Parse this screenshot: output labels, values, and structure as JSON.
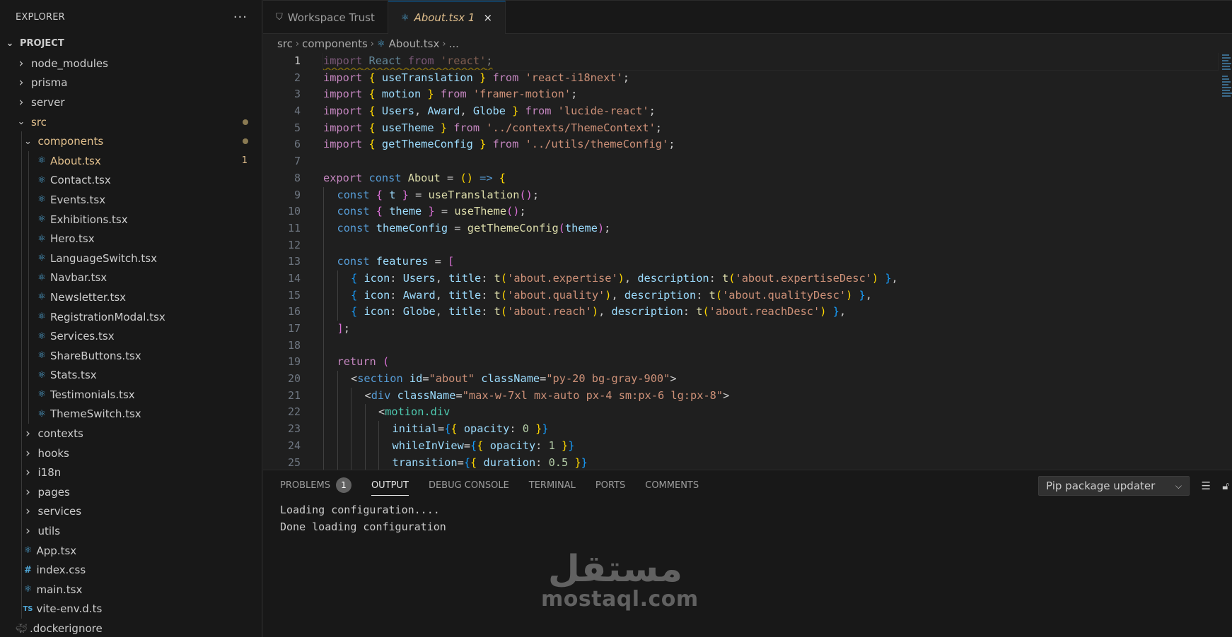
{
  "sidebar": {
    "title": "EXPLORER",
    "more_icon": "ellipsis-icon",
    "project": "PROJECT",
    "tree": [
      {
        "label": "node_modules",
        "depth": 0,
        "kind": "folder",
        "open": false
      },
      {
        "label": "prisma",
        "depth": 0,
        "kind": "folder",
        "open": false
      },
      {
        "label": "server",
        "depth": 0,
        "kind": "folder",
        "open": false
      },
      {
        "label": "src",
        "depth": 0,
        "kind": "folder",
        "open": true,
        "modified": true,
        "dot": true
      },
      {
        "label": "components",
        "depth": 1,
        "kind": "folder",
        "open": true,
        "modified": true,
        "dot": true
      },
      {
        "label": "About.tsx",
        "depth": 2,
        "kind": "react",
        "modified": true,
        "count": "1"
      },
      {
        "label": "Contact.tsx",
        "depth": 2,
        "kind": "react"
      },
      {
        "label": "Events.tsx",
        "depth": 2,
        "kind": "react"
      },
      {
        "label": "Exhibitions.tsx",
        "depth": 2,
        "kind": "react"
      },
      {
        "label": "Hero.tsx",
        "depth": 2,
        "kind": "react"
      },
      {
        "label": "LanguageSwitch.tsx",
        "depth": 2,
        "kind": "react"
      },
      {
        "label": "Navbar.tsx",
        "depth": 2,
        "kind": "react"
      },
      {
        "label": "Newsletter.tsx",
        "depth": 2,
        "kind": "react"
      },
      {
        "label": "RegistrationModal.tsx",
        "depth": 2,
        "kind": "react"
      },
      {
        "label": "Services.tsx",
        "depth": 2,
        "kind": "react"
      },
      {
        "label": "ShareButtons.tsx",
        "depth": 2,
        "kind": "react"
      },
      {
        "label": "Stats.tsx",
        "depth": 2,
        "kind": "react"
      },
      {
        "label": "Testimonials.tsx",
        "depth": 2,
        "kind": "react"
      },
      {
        "label": "ThemeSwitch.tsx",
        "depth": 2,
        "kind": "react"
      },
      {
        "label": "contexts",
        "depth": 1,
        "kind": "folder",
        "open": false
      },
      {
        "label": "hooks",
        "depth": 1,
        "kind": "folder",
        "open": false
      },
      {
        "label": "i18n",
        "depth": 1,
        "kind": "folder",
        "open": false
      },
      {
        "label": "pages",
        "depth": 1,
        "kind": "folder",
        "open": false
      },
      {
        "label": "services",
        "depth": 1,
        "kind": "folder",
        "open": false
      },
      {
        "label": "utils",
        "depth": 1,
        "kind": "folder",
        "open": false
      },
      {
        "label": "App.tsx",
        "depth": 1,
        "kind": "react"
      },
      {
        "label": "index.css",
        "depth": 1,
        "kind": "css"
      },
      {
        "label": "main.tsx",
        "depth": 1,
        "kind": "react"
      },
      {
        "label": "vite-env.d.ts",
        "depth": 1,
        "kind": "ts"
      },
      {
        "label": ".dockerignore",
        "depth": 0,
        "kind": "docker"
      }
    ]
  },
  "tabs": [
    {
      "label": "Workspace Trust",
      "icon": "shield-icon",
      "active": false
    },
    {
      "label": "About.tsx 1",
      "icon": "react-icon",
      "active": true,
      "close": "×"
    }
  ],
  "breadcrumb": {
    "parts": [
      "src",
      "components",
      "About.tsx",
      "..."
    ]
  },
  "editor": {
    "current_line": 1,
    "lines": [
      [
        [
          0,
          ""
        ],
        [
          "kw dimkw",
          "import"
        ],
        [
          "pu",
          " "
        ],
        [
          "vr",
          "React"
        ],
        [
          "pu",
          " "
        ],
        [
          "kw",
          "from"
        ],
        [
          "pu",
          " "
        ],
        [
          "st",
          "'react'"
        ],
        [
          "pu",
          ";"
        ]
      ],
      [
        [
          0,
          ""
        ],
        [
          "kw",
          "import"
        ],
        [
          "pu",
          " "
        ],
        [
          "b1",
          "{"
        ],
        [
          "pu",
          " "
        ],
        [
          "vr",
          "useTranslation"
        ],
        [
          "pu",
          " "
        ],
        [
          "b1",
          "}"
        ],
        [
          "pu",
          " "
        ],
        [
          "kw",
          "from"
        ],
        [
          "pu",
          " "
        ],
        [
          "st",
          "'react-i18next'"
        ],
        [
          "pu",
          ";"
        ]
      ],
      [
        [
          0,
          ""
        ],
        [
          "kw",
          "import"
        ],
        [
          "pu",
          " "
        ],
        [
          "b1",
          "{"
        ],
        [
          "pu",
          " "
        ],
        [
          "vr",
          "motion"
        ],
        [
          "pu",
          " "
        ],
        [
          "b1",
          "}"
        ],
        [
          "pu",
          " "
        ],
        [
          "kw",
          "from"
        ],
        [
          "pu",
          " "
        ],
        [
          "st",
          "'framer-motion'"
        ],
        [
          "pu",
          ";"
        ]
      ],
      [
        [
          0,
          ""
        ],
        [
          "kw",
          "import"
        ],
        [
          "pu",
          " "
        ],
        [
          "b1",
          "{"
        ],
        [
          "pu",
          " "
        ],
        [
          "vr",
          "Users"
        ],
        [
          "pu",
          ", "
        ],
        [
          "vr",
          "Award"
        ],
        [
          "pu",
          ", "
        ],
        [
          "vr",
          "Globe"
        ],
        [
          "pu",
          " "
        ],
        [
          "b1",
          "}"
        ],
        [
          "pu",
          " "
        ],
        [
          "kw",
          "from"
        ],
        [
          "pu",
          " "
        ],
        [
          "st",
          "'lucide-react'"
        ],
        [
          "pu",
          ";"
        ]
      ],
      [
        [
          0,
          ""
        ],
        [
          "kw",
          "import"
        ],
        [
          "pu",
          " "
        ],
        [
          "b1",
          "{"
        ],
        [
          "pu",
          " "
        ],
        [
          "vr",
          "useTheme"
        ],
        [
          "pu",
          " "
        ],
        [
          "b1",
          "}"
        ],
        [
          "pu",
          " "
        ],
        [
          "kw",
          "from"
        ],
        [
          "pu",
          " "
        ],
        [
          "st",
          "'../contexts/ThemeContext'"
        ],
        [
          "pu",
          ";"
        ]
      ],
      [
        [
          0,
          ""
        ],
        [
          "kw",
          "import"
        ],
        [
          "pu",
          " "
        ],
        [
          "b1",
          "{"
        ],
        [
          "pu",
          " "
        ],
        [
          "vr",
          "getThemeConfig"
        ],
        [
          "pu",
          " "
        ],
        [
          "b1",
          "}"
        ],
        [
          "pu",
          " "
        ],
        [
          "kw",
          "from"
        ],
        [
          "pu",
          " "
        ],
        [
          "st",
          "'../utils/themeConfig'"
        ],
        [
          "pu",
          ";"
        ]
      ],
      [
        [
          0,
          ""
        ]
      ],
      [
        [
          0,
          ""
        ],
        [
          "kw",
          "export"
        ],
        [
          "pu",
          " "
        ],
        [
          "kb",
          "const"
        ],
        [
          "pu",
          " "
        ],
        [
          "fn",
          "About"
        ],
        [
          "pu",
          " = "
        ],
        [
          "b1",
          "("
        ],
        [
          "b1",
          ")"
        ],
        [
          "pu",
          " "
        ],
        [
          "kb",
          "=>"
        ],
        [
          "pu",
          " "
        ],
        [
          "b1",
          "{"
        ]
      ],
      [
        [
          1,
          ""
        ],
        [
          "kb",
          "const"
        ],
        [
          "pu",
          " "
        ],
        [
          "b2",
          "{"
        ],
        [
          "pu",
          " "
        ],
        [
          "vr",
          "t"
        ],
        [
          "pu",
          " "
        ],
        [
          "b2",
          "}"
        ],
        [
          "pu",
          " = "
        ],
        [
          "fn",
          "useTranslation"
        ],
        [
          "b2",
          "("
        ],
        [
          "b2",
          ")"
        ],
        [
          "pu",
          ";"
        ]
      ],
      [
        [
          1,
          ""
        ],
        [
          "kb",
          "const"
        ],
        [
          "pu",
          " "
        ],
        [
          "b2",
          "{"
        ],
        [
          "pu",
          " "
        ],
        [
          "vr",
          "theme"
        ],
        [
          "pu",
          " "
        ],
        [
          "b2",
          "}"
        ],
        [
          "pu",
          " = "
        ],
        [
          "fn",
          "useTheme"
        ],
        [
          "b2",
          "("
        ],
        [
          "b2",
          ")"
        ],
        [
          "pu",
          ";"
        ]
      ],
      [
        [
          1,
          ""
        ],
        [
          "kb",
          "const"
        ],
        [
          "pu",
          " "
        ],
        [
          "vr",
          "themeConfig"
        ],
        [
          "pu",
          " = "
        ],
        [
          "fn",
          "getThemeConfig"
        ],
        [
          "b2",
          "("
        ],
        [
          "vr",
          "theme"
        ],
        [
          "b2",
          ")"
        ],
        [
          "pu",
          ";"
        ]
      ],
      [
        [
          1,
          ""
        ]
      ],
      [
        [
          1,
          ""
        ],
        [
          "kb",
          "const"
        ],
        [
          "pu",
          " "
        ],
        [
          "vr",
          "features"
        ],
        [
          "pu",
          " = "
        ],
        [
          "b2",
          "["
        ]
      ],
      [
        [
          2,
          ""
        ],
        [
          "b3",
          "{"
        ],
        [
          "pu",
          " "
        ],
        [
          "vr",
          "icon"
        ],
        [
          "pu",
          ": "
        ],
        [
          "vr",
          "Users"
        ],
        [
          "pu",
          ", "
        ],
        [
          "vr",
          "title"
        ],
        [
          "pu",
          ": "
        ],
        [
          "fn",
          "t"
        ],
        [
          "b1",
          "("
        ],
        [
          "st",
          "'about.expertise'"
        ],
        [
          "b1",
          ")"
        ],
        [
          "pu",
          ", "
        ],
        [
          "vr",
          "description"
        ],
        [
          "pu",
          ": "
        ],
        [
          "fn",
          "t"
        ],
        [
          "b1",
          "("
        ],
        [
          "st",
          "'about.expertiseDesc'"
        ],
        [
          "b1",
          ")"
        ],
        [
          "pu",
          " "
        ],
        [
          "b3",
          "}"
        ],
        [
          "pu",
          ","
        ]
      ],
      [
        [
          2,
          ""
        ],
        [
          "b3",
          "{"
        ],
        [
          "pu",
          " "
        ],
        [
          "vr",
          "icon"
        ],
        [
          "pu",
          ": "
        ],
        [
          "vr",
          "Award"
        ],
        [
          "pu",
          ", "
        ],
        [
          "vr",
          "title"
        ],
        [
          "pu",
          ": "
        ],
        [
          "fn",
          "t"
        ],
        [
          "b1",
          "("
        ],
        [
          "st",
          "'about.quality'"
        ],
        [
          "b1",
          ")"
        ],
        [
          "pu",
          ", "
        ],
        [
          "vr",
          "description"
        ],
        [
          "pu",
          ": "
        ],
        [
          "fn",
          "t"
        ],
        [
          "b1",
          "("
        ],
        [
          "st",
          "'about.qualityDesc'"
        ],
        [
          "b1",
          ")"
        ],
        [
          "pu",
          " "
        ],
        [
          "b3",
          "}"
        ],
        [
          "pu",
          ","
        ]
      ],
      [
        [
          2,
          ""
        ],
        [
          "b3",
          "{"
        ],
        [
          "pu",
          " "
        ],
        [
          "vr",
          "icon"
        ],
        [
          "pu",
          ": "
        ],
        [
          "vr",
          "Globe"
        ],
        [
          "pu",
          ", "
        ],
        [
          "vr",
          "title"
        ],
        [
          "pu",
          ": "
        ],
        [
          "fn",
          "t"
        ],
        [
          "b1",
          "("
        ],
        [
          "st",
          "'about.reach'"
        ],
        [
          "b1",
          ")"
        ],
        [
          "pu",
          ", "
        ],
        [
          "vr",
          "description"
        ],
        [
          "pu",
          ": "
        ],
        [
          "fn",
          "t"
        ],
        [
          "b1",
          "("
        ],
        [
          "st",
          "'about.reachDesc'"
        ],
        [
          "b1",
          ")"
        ],
        [
          "pu",
          " "
        ],
        [
          "b3",
          "}"
        ],
        [
          "pu",
          ","
        ]
      ],
      [
        [
          1,
          ""
        ],
        [
          "b2",
          "]"
        ],
        [
          "pu",
          ";"
        ]
      ],
      [
        [
          1,
          ""
        ]
      ],
      [
        [
          1,
          ""
        ],
        [
          "kw",
          "return"
        ],
        [
          "pu",
          " "
        ],
        [
          "b2",
          "("
        ]
      ],
      [
        [
          2,
          ""
        ],
        [
          "pu",
          "<"
        ],
        [
          "tg",
          "section"
        ],
        [
          "pu",
          " "
        ],
        [
          "at",
          "id"
        ],
        [
          "pu",
          "="
        ],
        [
          "st",
          "\"about\""
        ],
        [
          "pu",
          " "
        ],
        [
          "at",
          "className"
        ],
        [
          "pu",
          "="
        ],
        [
          "st",
          "\"py-20 bg-gray-900\""
        ],
        [
          "pu",
          ">"
        ]
      ],
      [
        [
          3,
          ""
        ],
        [
          "pu",
          "<"
        ],
        [
          "tg",
          "div"
        ],
        [
          "pu",
          " "
        ],
        [
          "at",
          "className"
        ],
        [
          "pu",
          "="
        ],
        [
          "st",
          "\"max-w-7xl mx-auto px-4 sm:px-6 lg:px-8\""
        ],
        [
          "pu",
          ">"
        ]
      ],
      [
        [
          4,
          ""
        ],
        [
          "pu",
          "<"
        ],
        [
          "ty",
          "motion.div"
        ]
      ],
      [
        [
          5,
          ""
        ],
        [
          "at",
          "initial"
        ],
        [
          "pu",
          "="
        ],
        [
          "b3",
          "{"
        ],
        [
          "b1",
          "{"
        ],
        [
          "pu",
          " "
        ],
        [
          "vr",
          "opacity"
        ],
        [
          "pu",
          ": "
        ],
        [
          "nm",
          "0"
        ],
        [
          "pu",
          " "
        ],
        [
          "b1",
          "}"
        ],
        [
          "b3",
          "}"
        ]
      ],
      [
        [
          5,
          ""
        ],
        [
          "at",
          "whileInView"
        ],
        [
          "pu",
          "="
        ],
        [
          "b3",
          "{"
        ],
        [
          "b1",
          "{"
        ],
        [
          "pu",
          " "
        ],
        [
          "vr",
          "opacity"
        ],
        [
          "pu",
          ": "
        ],
        [
          "nm",
          "1"
        ],
        [
          "pu",
          " "
        ],
        [
          "b1",
          "}"
        ],
        [
          "b3",
          "}"
        ]
      ],
      [
        [
          5,
          ""
        ],
        [
          "at",
          "transition"
        ],
        [
          "pu",
          "="
        ],
        [
          "b3",
          "{"
        ],
        [
          "b1",
          "{"
        ],
        [
          "pu",
          " "
        ],
        [
          "vr",
          "duration"
        ],
        [
          "pu",
          ": "
        ],
        [
          "nm",
          "0.5"
        ],
        [
          "pu",
          " "
        ],
        [
          "b1",
          "}"
        ],
        [
          "b3",
          "}"
        ]
      ]
    ]
  },
  "panel": {
    "tabs": [
      {
        "label": "PROBLEMS",
        "badge": "1",
        "active": false
      },
      {
        "label": "OUTPUT",
        "active": true
      },
      {
        "label": "DEBUG CONSOLE",
        "active": false
      },
      {
        "label": "TERMINAL",
        "active": false
      },
      {
        "label": "PORTS",
        "active": false
      },
      {
        "label": "COMMENTS",
        "active": false
      }
    ],
    "channel": "Pip package updater",
    "output": [
      "Loading configuration....",
      "Done loading configuration"
    ],
    "tools": {
      "clear": "clear-output-icon",
      "lock": "lock-icon"
    }
  },
  "watermark": {
    "arabic": "مستقل",
    "latin": "mostaql.com"
  },
  "colors": {
    "accent": "#0078d4",
    "modified": "#e2c08d",
    "react_icon": "#4fa6d6",
    "editor_bg": "#1f1f1f",
    "sidebar_bg": "#181818"
  }
}
